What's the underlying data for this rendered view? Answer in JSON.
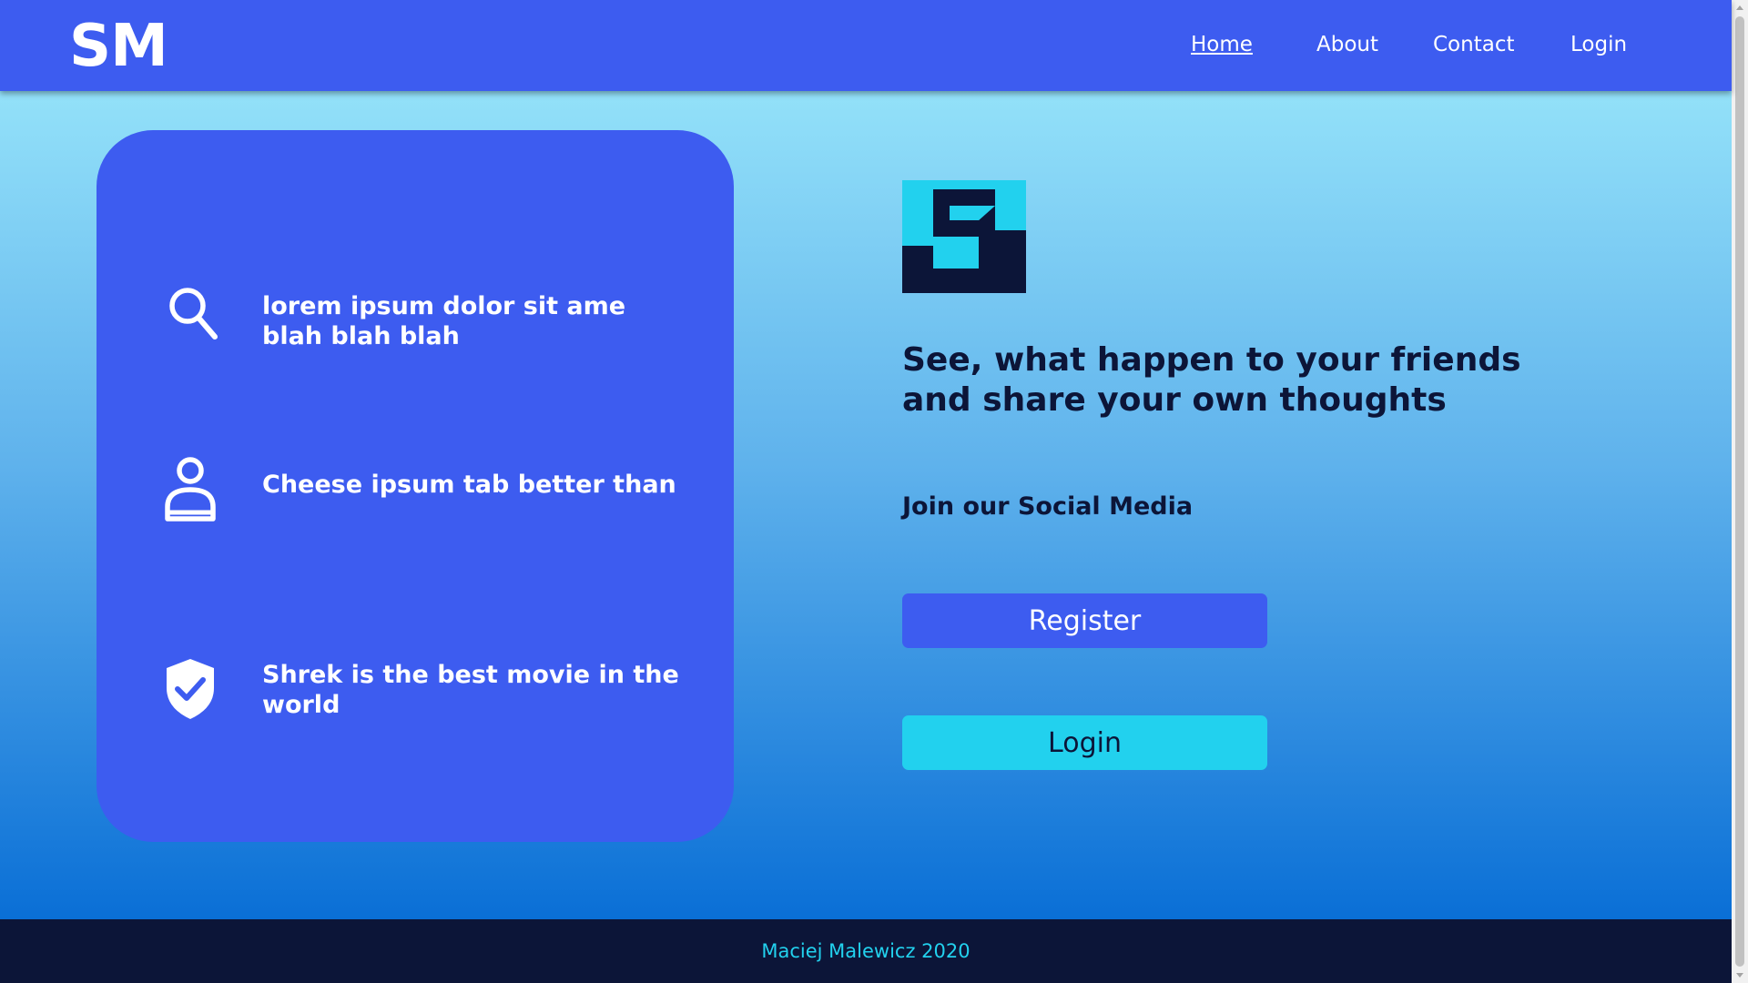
{
  "header": {
    "logo": "SM",
    "nav": [
      {
        "label": "Home",
        "active": true
      },
      {
        "label": "About",
        "active": false
      },
      {
        "label": "Contact",
        "active": false
      },
      {
        "label": "Login",
        "active": false
      }
    ]
  },
  "features": [
    {
      "icon": "search-icon",
      "text": "lorem ipsum dolor sit ame blah blah blah"
    },
    {
      "icon": "user-icon",
      "text": "Cheese ipsum tab better than"
    },
    {
      "icon": "shield-check-icon",
      "text": "Shrek is the best movie in the world"
    }
  ],
  "hero": {
    "brand_icon": "s-block-logo-icon",
    "tagline": "See, what happen to your friends and share your own thoughts",
    "join": "Join our Social Media",
    "register_label": "Register",
    "login_label": "Login"
  },
  "footer": {
    "text": "Maciej Malewicz 2020"
  },
  "colors": {
    "primary": "#3d5cf0",
    "accent": "#22d1ee",
    "dark": "#0c1538",
    "gradient_top": "#93e1f9",
    "gradient_bottom": "#0a6fd6"
  }
}
